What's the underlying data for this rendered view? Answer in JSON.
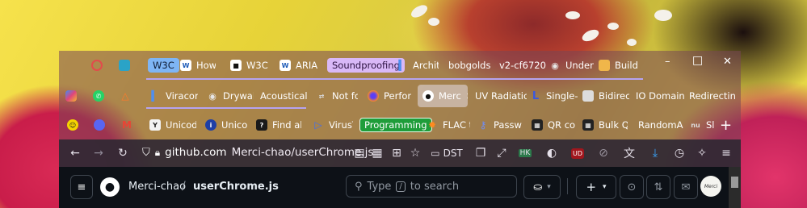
{
  "window_controls": {
    "minimize": "–",
    "maximize": "□",
    "close": "✕"
  },
  "row1": {
    "tabs": [
      {
        "label": "W3C",
        "style": "blue-pill"
      },
      {
        "label": "How t"
      },
      {
        "label": "W3C C"
      },
      {
        "label": "ARIA r"
      },
      {
        "label": "Soundproofing",
        "style": "purple-pill"
      },
      {
        "label": "Archit"
      },
      {
        "label": "bobgolds"
      },
      {
        "label": "v2-cf6720"
      },
      {
        "label": "Under"
      },
      {
        "label": "Build"
      }
    ]
  },
  "row2": {
    "tabs": [
      {
        "label": "Viracor"
      },
      {
        "label": "Drywal"
      },
      {
        "label": "Acoustical"
      },
      {
        "label": "Not fo"
      },
      {
        "label": "Perfor"
      },
      {
        "label": "Merc",
        "active": true
      },
      {
        "label": "UV Radiatio"
      },
      {
        "label": "Single-"
      },
      {
        "label": "Bidirec"
      },
      {
        "label": "IO Domain"
      },
      {
        "label": "Redirectin"
      }
    ]
  },
  "row3": {
    "tabs": [
      {
        "label": "Unicod"
      },
      {
        "label": "Unicod"
      },
      {
        "label": "Find al"
      },
      {
        "label": "VirusTo"
      },
      {
        "label": "Programming",
        "style": "green-pill"
      },
      {
        "label": "FLAC t"
      },
      {
        "label": "Passw"
      },
      {
        "label": "QR co"
      },
      {
        "label": "Bulk Q"
      },
      {
        "label": "RandomA"
      },
      {
        "label": "Sl"
      }
    ],
    "new_tab": "+"
  },
  "navbar": {
    "domain": "github.com",
    "path": "Merci-chao/userChrome.js",
    "dst_label": "DST",
    "hk_badge": "HK",
    "ud_badge": "UD"
  },
  "github": {
    "owner": "Merci-chao",
    "separator": "/",
    "repo": "userChrome.js",
    "search_placeholder_before": "Type",
    "search_key": "/",
    "search_placeholder_after": "to search",
    "plus_label": "+"
  },
  "colors": {
    "blue_pill": "#7eb5f5",
    "purple_pill": "#d9b8f7",
    "green_pill": "#1f9d3a",
    "github_bg": "#0d1117",
    "navbar_bg": "#302834"
  }
}
